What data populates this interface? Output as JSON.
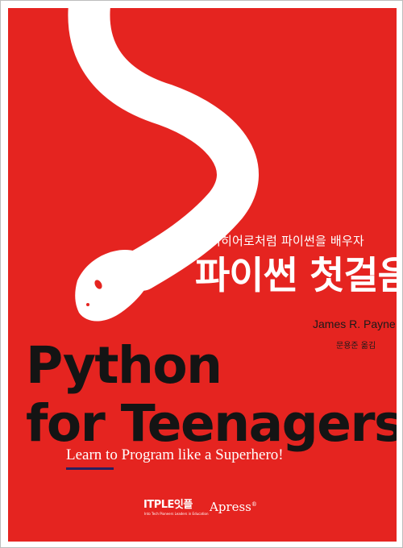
{
  "cover": {
    "background_color": "#e52420",
    "snake_color": "#ffffff",
    "snake_icon": "snake-illustration"
  },
  "korean_subtitle": "슈퍼히어로처럼 파이썬을 배우자",
  "korean_title": "파이썬 첫걸음",
  "author": "James R. Payne",
  "translator": "문용준 옮김",
  "english_title": {
    "line1": "Python",
    "line2": "for Teenagers"
  },
  "tagline": "Learn to Program like a Superhero!",
  "publishers": {
    "itple": "ITPLE",
    "itple_korean": "잇플",
    "itple_tagline": "Into Tech Pioneers Leaders in Education",
    "apress": "Apress",
    "apress_mark": "®"
  }
}
